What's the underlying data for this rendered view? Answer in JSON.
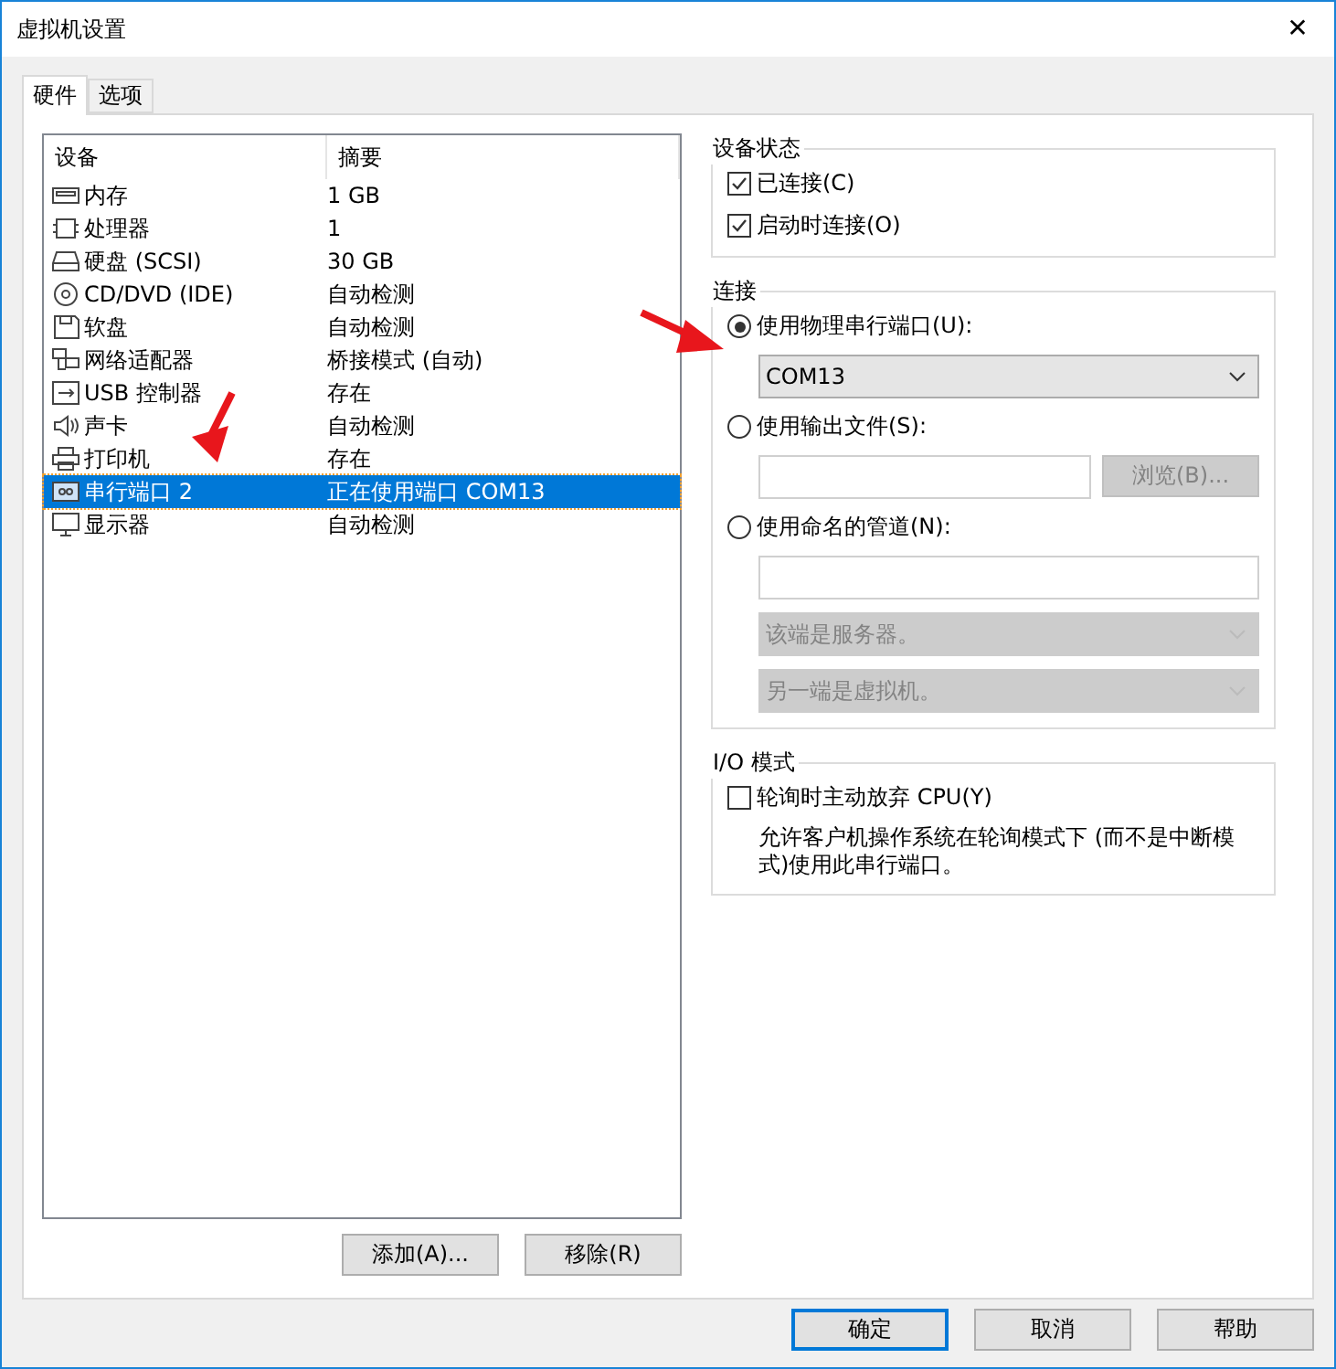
{
  "window": {
    "title": "虚拟机设置",
    "close": "✕"
  },
  "tabs": [
    {
      "label": "硬件",
      "selected": true
    },
    {
      "label": "选项",
      "selected": false
    }
  ],
  "device_list": {
    "columns": [
      "设备",
      "摘要"
    ],
    "rows": [
      {
        "device": "内存",
        "summary": "1 GB",
        "selected": false
      },
      {
        "device": "处理器",
        "summary": "1",
        "selected": false
      },
      {
        "device": "硬盘 (SCSI)",
        "summary": "30 GB",
        "selected": false
      },
      {
        "device": "CD/DVD (IDE)",
        "summary": "自动检测",
        "selected": false
      },
      {
        "device": "软盘",
        "summary": "自动检测",
        "selected": false
      },
      {
        "device": "网络适配器",
        "summary": "桥接模式 (自动)",
        "selected": false
      },
      {
        "device": "USB 控制器",
        "summary": "存在",
        "selected": false
      },
      {
        "device": "声卡",
        "summary": "自动检测",
        "selected": false
      },
      {
        "device": "打印机",
        "summary": "存在",
        "selected": false
      },
      {
        "device": "串行端口 2",
        "summary": "正在使用端口 COM13",
        "selected": true
      },
      {
        "device": "显示器",
        "summary": "自动检测",
        "selected": false
      }
    ]
  },
  "list_buttons": [
    "添加(A)...",
    "移除(R)"
  ],
  "device_status": {
    "title": "设备状态",
    "options": [
      {
        "label": "已连接(C)",
        "checked": true
      },
      {
        "label": "启动时连接(O)",
        "checked": true
      }
    ]
  },
  "connection": {
    "title": "连接",
    "options": [
      {
        "label": "使用物理串行端口(U):",
        "selected": true
      },
      {
        "label": "使用输出文件(S):",
        "selected": false
      },
      {
        "label": "使用命名的管道(N):",
        "selected": false
      }
    ],
    "port_select": {
      "value": "COM13",
      "disabled": false
    },
    "browse_button": {
      "label": "浏览(B)...",
      "disabled": true
    },
    "pipe_end_select": {
      "value": "该端是服务器。",
      "disabled": true
    },
    "pipe_other_select": {
      "value": "另一端是虚拟机。",
      "disabled": true
    }
  },
  "io_mode": {
    "title": "I/O 模式",
    "option": {
      "label": "轮询时主动放弃 CPU(Y)",
      "checked": false
    },
    "description": "允许客户机操作系统在轮询模式下 (而不是中断模式)使用此串行端口。"
  },
  "footer_buttons": [
    {
      "label": "确定",
      "default": true
    },
    {
      "label": "取消",
      "default": false
    },
    {
      "label": "帮助",
      "default": false
    }
  ]
}
